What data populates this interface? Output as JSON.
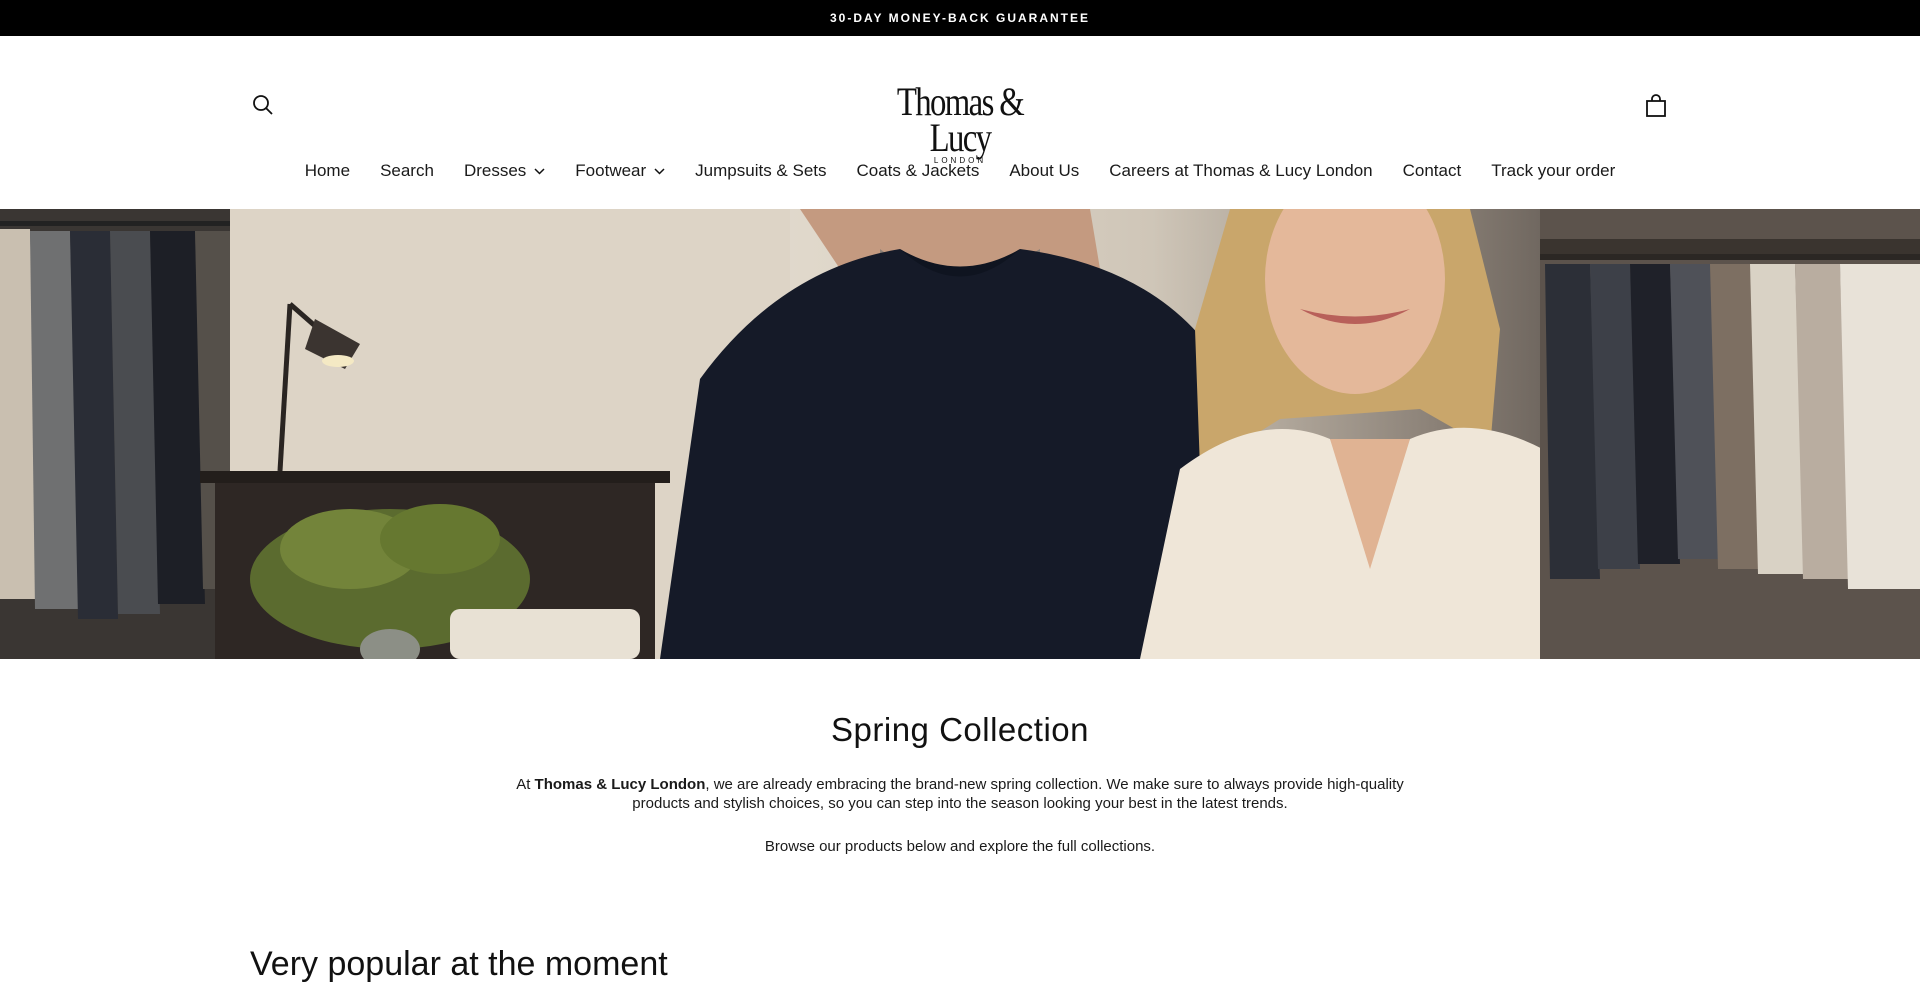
{
  "announcement": {
    "text": "30-DAY MONEY-BACK GUARANTEE"
  },
  "header": {
    "logo_main": "Thomas & Lucy",
    "logo_sub": "LONDON",
    "search_icon": "search-icon",
    "cart_icon": "shopping-bag-icon"
  },
  "nav": {
    "items": [
      {
        "label": "Home"
      },
      {
        "label": "Search"
      },
      {
        "label": "Dresses",
        "dropdown": true
      },
      {
        "label": "Footwear",
        "dropdown": true
      },
      {
        "label": "Jumpsuits & Sets"
      },
      {
        "label": "Coats & Jackets"
      },
      {
        "label": "About Us"
      },
      {
        "label": "Careers at Thomas & Lucy London"
      },
      {
        "label": "Contact"
      },
      {
        "label": "Track your order"
      }
    ]
  },
  "intro": {
    "title": "Spring Collection",
    "p1_prefix": "At ",
    "p1_brand": "Thomas & Lucy London",
    "p1_rest": ", we are already embracing the brand-new spring collection. We make sure to always provide high-quality products and stylish choices, so you can step into the season looking your best in the latest trends.",
    "p2": "Browse our products below and explore the full collections."
  },
  "popular": {
    "title": "Very popular at the moment"
  }
}
